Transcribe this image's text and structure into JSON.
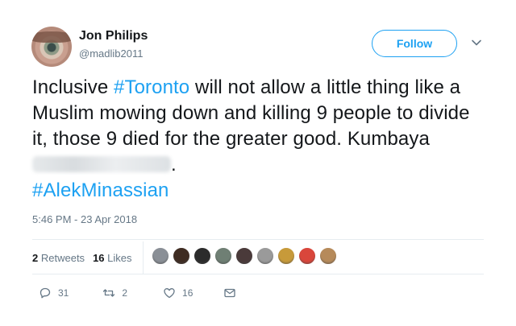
{
  "author": {
    "name": "Jon Philips",
    "handle": "@madlib2011"
  },
  "header": {
    "follow_label": "Follow",
    "caret_icon": "chevron-down-icon"
  },
  "tweet": {
    "part1": "Inclusive ",
    "hashtag1": "#Toronto",
    "part2": " will not allow a little thing like a Muslim mowing down and killing 9 people to divide it, those 9 died for the greater good. Kumbaya ",
    "part3": ".",
    "hashtag2": "#AlekMinassian"
  },
  "timestamp": "5:46 PM - 23 Apr 2018",
  "stats": {
    "retweets_count": "2",
    "retweets_label": "Retweets",
    "likes_count": "16",
    "likes_label": "Likes"
  },
  "likers": {
    "colors": [
      "#8a8f96",
      "#3f2c22",
      "#2b2b2b",
      "#6f7f74",
      "#4a3a3a",
      "#9a9a9a",
      "#c79a3a",
      "#d9463b",
      "#b68a5a"
    ]
  },
  "actions": {
    "reply_count": "31",
    "retweet_count": "2",
    "like_count": "16"
  },
  "colors": {
    "link": "#1da1f2",
    "muted": "#657786"
  }
}
